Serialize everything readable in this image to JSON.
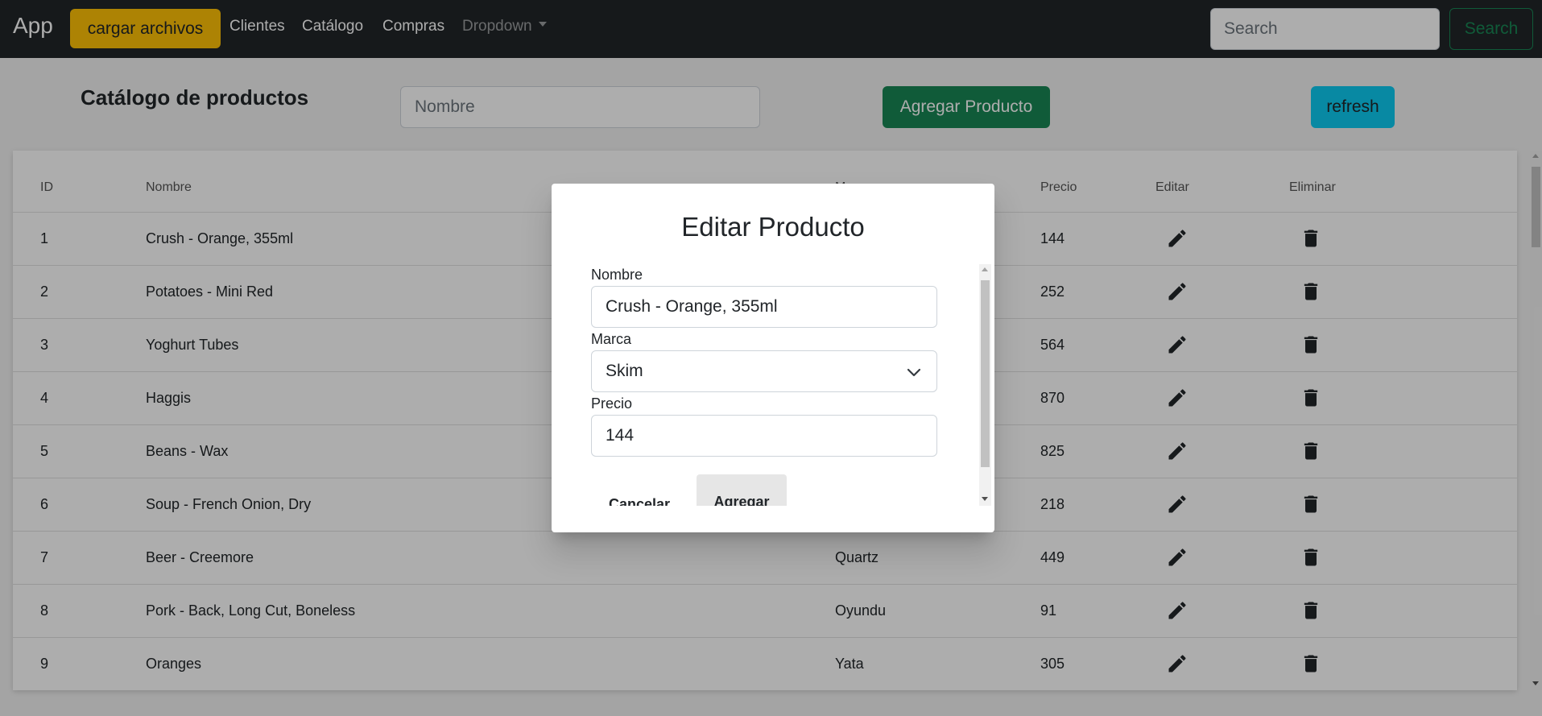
{
  "navbar": {
    "brand": "App",
    "upload_label": "cargar archivos",
    "links": [
      "Clientes",
      "Catálogo",
      "Compras"
    ],
    "dropdown_label": "Dropdown",
    "search_placeholder": "Search",
    "search_button": "Search"
  },
  "header": {
    "title": "Catálogo de productos",
    "nombre_placeholder": "Nombre",
    "add_button": "Agregar Producto",
    "refresh_button": "refresh"
  },
  "table": {
    "columns": [
      "ID",
      "Nombre",
      "Marca",
      "Precio",
      "Editar",
      "Eliminar"
    ],
    "rows": [
      {
        "id": "1",
        "nombre": "Crush - Orange, 355ml",
        "marca": "",
        "precio": "144"
      },
      {
        "id": "2",
        "nombre": "Potatoes - Mini Red",
        "marca": "",
        "precio": "252"
      },
      {
        "id": "3",
        "nombre": "Yoghurt Tubes",
        "marca": "",
        "precio": "564"
      },
      {
        "id": "4",
        "nombre": "Haggis",
        "marca": "",
        "precio": "870"
      },
      {
        "id": "5",
        "nombre": "Beans - Wax",
        "marca": "",
        "precio": "825"
      },
      {
        "id": "6",
        "nombre": "Soup - French Onion, Dry",
        "marca": "",
        "precio": "218"
      },
      {
        "id": "7",
        "nombre": "Beer - Creemore",
        "marca": "Quartz",
        "precio": "449"
      },
      {
        "id": "8",
        "nombre": "Pork - Back, Long Cut, Boneless",
        "marca": "Oyundu",
        "precio": "91"
      },
      {
        "id": "9",
        "nombre": "Oranges",
        "marca": "Yata",
        "precio": "305"
      }
    ]
  },
  "modal": {
    "title": "Editar Producto",
    "nombre_label": "Nombre",
    "nombre_value": "Crush - Orange, 355ml",
    "marca_label": "Marca",
    "marca_value": "Skim",
    "precio_label": "Precio",
    "precio_value": "144",
    "cancel_button": "Cancelar",
    "add_button": "Agregar"
  },
  "icons": {
    "edit": "pencil-icon",
    "delete": "trash-icon",
    "select": "chevron-down-icon"
  }
}
